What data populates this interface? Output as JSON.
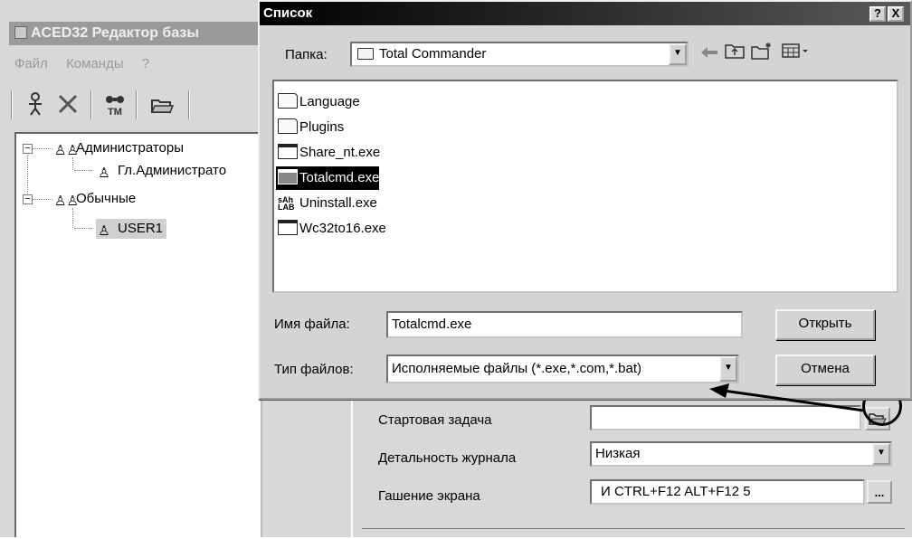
{
  "main_window": {
    "title": "ACED32 Редактор базы",
    "menu": [
      "Файл",
      "Команды",
      "?"
    ],
    "tree": [
      {
        "label": "Администраторы",
        "level": 0,
        "icon": "users-group-icon"
      },
      {
        "label": "Гл.Администрато",
        "level": 1,
        "icon": "user-icon"
      },
      {
        "label": "Обычные",
        "level": 0,
        "icon": "users-group-icon"
      },
      {
        "label": "USER1",
        "level": 1,
        "icon": "user-icon"
      }
    ],
    "properties": {
      "start_task_label": "Стартовая задача",
      "start_task_value": "",
      "log_detail_label": "Детальность журнала",
      "log_detail_value": "Низкая",
      "screen_blank_label": "Гашение экрана",
      "screen_blank_value": "И CTRL+F12 ALT+F12 5",
      "ellipsis": "..."
    }
  },
  "dialog": {
    "title": "Список",
    "help_btn": "?",
    "close_btn": "X",
    "folder_label": "Папка:",
    "folder_value": "Total Commander",
    "files": [
      {
        "name": "Language",
        "type": "folder"
      },
      {
        "name": "Plugins",
        "type": "folder"
      },
      {
        "name": "Share_nt.exe",
        "type": "exe"
      },
      {
        "name": "Totalcmd.exe",
        "type": "exe",
        "selected": true
      },
      {
        "name": "Uninstall.exe",
        "type": "uninstall"
      },
      {
        "name": "Wc32to16.exe",
        "type": "exe"
      }
    ],
    "filename_label": "Имя файла:",
    "filename_value": "Totalcmd.exe",
    "filetype_label": "Тип файлов:",
    "filetype_value": "Исполняемые файлы (*.exe,*.com,*.bat)",
    "open_btn": "Открыть",
    "cancel_btn": "Отмена"
  }
}
